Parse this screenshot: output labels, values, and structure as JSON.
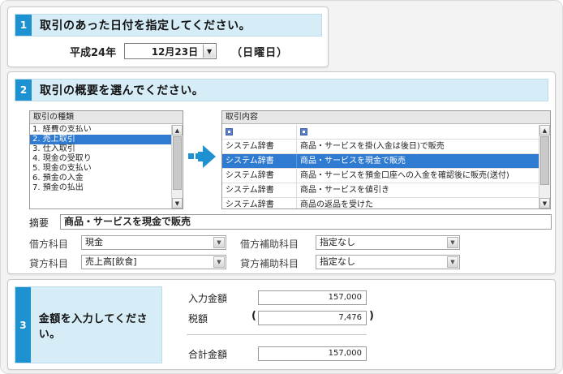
{
  "section1": {
    "number": "1",
    "title": "取引のあった日付を指定してください。",
    "era_year": "平成24年",
    "date_value": "12月23日",
    "weekday": "（日曜日）"
  },
  "section2": {
    "number": "2",
    "title": "取引の概要を選んでください。",
    "type_list": {
      "title": "取引の種類",
      "items": [
        "1. 経費の支払い",
        "2. 売上取引",
        "3. 仕入取引",
        "4. 現金の受取り",
        "5. 現金の支払い",
        "6. 預金の入金",
        "7. 預金の払出"
      ],
      "selected_index": 1
    },
    "content_list": {
      "title": "取引内容",
      "rows": [
        {
          "source": "システム辞書",
          "content": "商品・サービスを掛(入金は後日)で販売"
        },
        {
          "source": "システム辞書",
          "content": "商品・サービスを現金で販売"
        },
        {
          "source": "システム辞書",
          "content": "商品・サービスを預金口座への入金を確認後に販売(送付)"
        },
        {
          "source": "システム辞書",
          "content": "商品・サービスを値引き"
        },
        {
          "source": "システム辞書",
          "content": "商品の返品を受けた"
        }
      ],
      "selected_index": 1
    },
    "summary_label": "摘要",
    "summary_value": "商品・サービスを現金で販売",
    "debit_account_label": "借方科目",
    "debit_account_value": "現金",
    "debit_sub_label": "借方補助科目",
    "debit_sub_value": "指定なし",
    "credit_account_label": "貸方科目",
    "credit_account_value": "売上高[飲食]",
    "credit_sub_label": "貸方補助科目",
    "credit_sub_value": "指定なし"
  },
  "section3": {
    "number": "3",
    "title": "金額を入力してください。",
    "input_amount_label": "入力金額",
    "input_amount_value": "157,000",
    "tax_label": "税額",
    "tax_value": "7,476",
    "paren_open": "(",
    "paren_close": ")",
    "total_label": "合計金額",
    "total_value": "157,000"
  },
  "colors": {
    "accent": "#1e92d0",
    "header_bg": "#d6edf8",
    "selection": "#2f7bd1",
    "arrow": "#1e92d0"
  }
}
